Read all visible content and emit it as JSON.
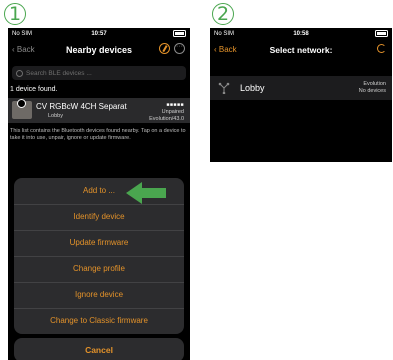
{
  "steps": {
    "first": "1",
    "second": "2"
  },
  "phone1": {
    "status": {
      "carrier": "No SIM",
      "time": "10:57"
    },
    "nav": {
      "back": "Back",
      "title": "Nearby devices"
    },
    "search": {
      "placeholder": "Search BLE devices ..."
    },
    "found_text": "1 device found.",
    "device": {
      "name": "CV RGBcW 4CH Separat",
      "group": "Lobby",
      "state": "Unpaired",
      "firmware": "Evolution/43.0"
    },
    "hint": "This list contains the Bluetooth devices found nearby. Tap on a device to take it into use, unpair, ignore or update firmware.",
    "actions": [
      "Add to ...",
      "Identify device",
      "Update firmware",
      "Change profile",
      "Ignore device",
      "Change to Classic firmware"
    ],
    "cancel": "Cancel"
  },
  "phone2": {
    "status": {
      "carrier": "No SIM",
      "time": "10:58"
    },
    "nav": {
      "back": "Back",
      "title": "Select network:"
    },
    "network": {
      "name": "Lobby",
      "type": "Evolution",
      "devices": "No devices"
    }
  },
  "colors": {
    "accent": "#e3922a",
    "arrow": "#4aa64f",
    "background": "#000000"
  }
}
